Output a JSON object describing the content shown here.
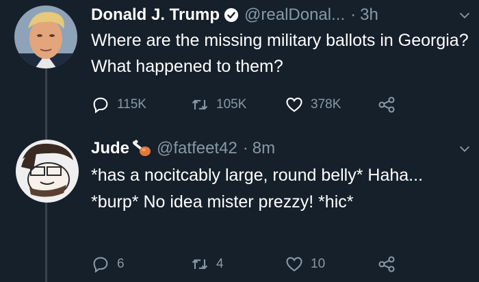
{
  "tweets": [
    {
      "name": "Donald J. Trump",
      "verified": true,
      "handle": "@realDonal...",
      "time": "3h",
      "text": "Where are the missing military ballots in Georgia? What happened to them?",
      "replies": "115K",
      "retweets": "105K",
      "likes": "378K"
    },
    {
      "name": "Jude",
      "emoji": "meat-on-bone-icon",
      "handle": "@fatfeet42",
      "time": "8m",
      "text": "*has a nocitcably large, round belly* Haha... *burp* No idea mister prezzy! *hic*",
      "replies": "6",
      "retweets": "4",
      "likes": "10"
    }
  ],
  "colors": {
    "background": "#15202b",
    "secondary_text": "#8899a6",
    "verified_badge": "#ffffff",
    "thread_line": "#38444d"
  }
}
